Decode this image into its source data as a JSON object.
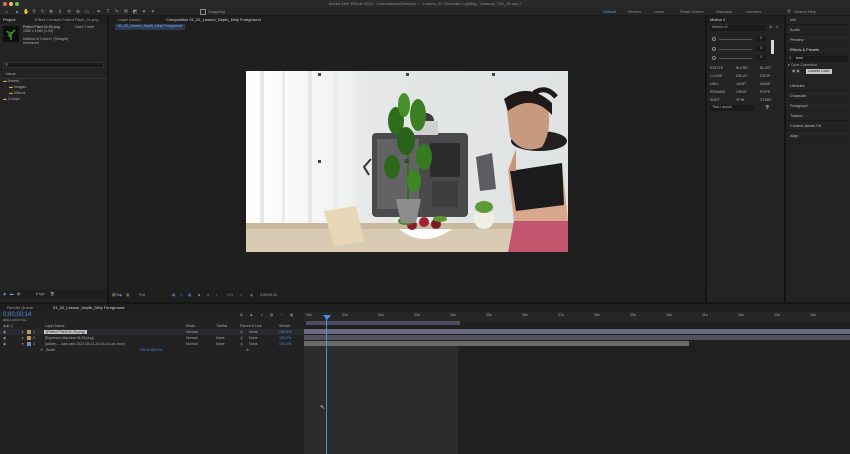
{
  "window": {
    "title": "Adobe After Effects 2022 - /Users/sharp/Desktop/... · Lesson_03 Cinematic Lighting · Lessons_V01_01.aep *"
  },
  "toolbar": {
    "snapping_label": "Snapping",
    "workspaces": [
      "Default",
      "Review",
      "Learn",
      "Small Screen",
      "Standard",
      "Libraries"
    ],
    "active_workspace": "Default",
    "search_placeholder": "Search Help"
  },
  "project": {
    "tabs": [
      "Project",
      "Effect Controls Potted Plant_04.png"
    ],
    "selected_item": {
      "name": "Potted Plant.04.26.png",
      "line1": "1080 x 1080 (1.00)",
      "line2": "Millions of Colors+ (Straight)",
      "line3": "Interlaced",
      "usage": "Used 1 time"
    },
    "column_header": "Name",
    "tree": [
      {
        "label": "Assets",
        "level": 0
      },
      {
        "label": "Images",
        "level": 1
      },
      {
        "label": "Videos",
        "level": 1
      },
      {
        "label": "Comps",
        "level": 0
      }
    ],
    "footer_bpc": "8 bpc"
  },
  "viewer": {
    "tabs": [
      "Layer (none)",
      "Composition 01_02_Lesson_Depth_Dirty Foreground"
    ],
    "comp_crumb": "01_02_Lesson_Depth_Dirty Foreground",
    "zoom": "25%",
    "quality": "Full",
    "timecode": "0;00;00;14",
    "exposure": "+0.0"
  },
  "motion": {
    "panel_title": "Motion 2",
    "preset": "Motion v2",
    "value1": "0",
    "value2": "0",
    "value3": "0",
    "value4": "0",
    "buttons": [
      "EXCITE",
      "BLEND",
      "BLAST",
      "CLONE",
      "DELAY",
      "DROP",
      "NULL",
      "JUMP",
      "NAME",
      "RENAME",
      "ORBIT",
      "ROPE",
      "SORT",
      "SPIN",
      "STARE",
      "VIGNETTE"
    ],
    "task_launcher": "Task Launch"
  },
  "right_panels": {
    "items": [
      "Info",
      "Audio",
      "Preview",
      "Effects & Presets",
      "Libraries",
      "Character",
      "Paragraph",
      "Tracker",
      "Content-Aware Fill",
      "Align"
    ],
    "search_value": "tone",
    "tree_parent": "Color Correction",
    "effect_name": "Lumetri Color"
  },
  "timeline": {
    "tabs": [
      "Render Queue",
      "01_02_Lesson_Depth_Dirty Foreground"
    ],
    "timecode": "0;00;00;14",
    "fps_line": "00014 (29.97 fps)",
    "columns": {
      "layer_name": "Layer Name",
      "mode": "Mode",
      "track": "TrkMat",
      "parent": "Parent & Link",
      "stretch": "Stretch"
    },
    "layers": [
      {
        "num": "1",
        "name": "[Potted Plant.04.26.png]",
        "mode": "Normal",
        "trk": "",
        "parent": "None",
        "stretch": "100.0%"
      },
      {
        "num": "2",
        "name": "[Espresso Machine.04.26.png]",
        "mode": "Normal",
        "trk": "None",
        "parent": "None",
        "stretch": "100.0%"
      },
      {
        "num": "3",
        "name": "[adobe-...-cam-tabl.2022-08-11-20-04-15-utc.mov]",
        "mode": "Normal",
        "trk": "None",
        "parent": "None",
        "stretch": "100.0%"
      }
    ],
    "scale_label": "Scale",
    "scale_value": "100.0,100.0%",
    "ruler_ticks": [
      "00s",
      "01s",
      "02s",
      "03s",
      "04s",
      "05s",
      "06s",
      "07s",
      "08s",
      "09s",
      "10s",
      "11s",
      "12s",
      "13s",
      "14s"
    ],
    "footer_label": "Toggle Switches / Modes"
  },
  "colors": {
    "accent": "#2d8ceb",
    "panel": "#232323",
    "bg": "#1d1d1d",
    "bar_selected": "#5a5a6e",
    "bar_layer": "#4c4c55",
    "bar_video": "#6a6a6a"
  }
}
